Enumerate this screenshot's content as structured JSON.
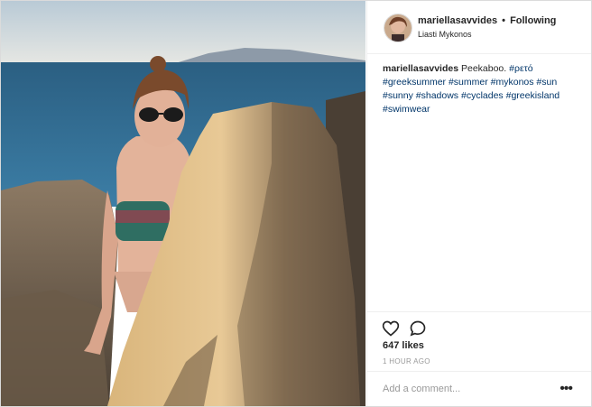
{
  "post": {
    "username": "mariellasavvides",
    "separator": "•",
    "follow_label": "Following",
    "location": "Liasti Mykonos",
    "caption_user": "mariellasavvides",
    "caption_text": "Peekaboo.",
    "hashtags": [
      "#ρετό",
      "#greeksummer",
      "#summer",
      "#mykonos",
      "#sun",
      "#sunny",
      "#shadows",
      "#cyclades",
      "#greekisland",
      "#swimwear"
    ],
    "likes": "647 likes",
    "timestamp": "1 HOUR AGO",
    "comment_placeholder": "Add a comment...",
    "more_label": "•••"
  },
  "icons": {
    "like": "heart-icon",
    "comment": "comment-icon",
    "more": "more-options-icon"
  },
  "colors": {
    "hashtag": "#003569",
    "muted": "#999999",
    "border": "#efefef"
  }
}
